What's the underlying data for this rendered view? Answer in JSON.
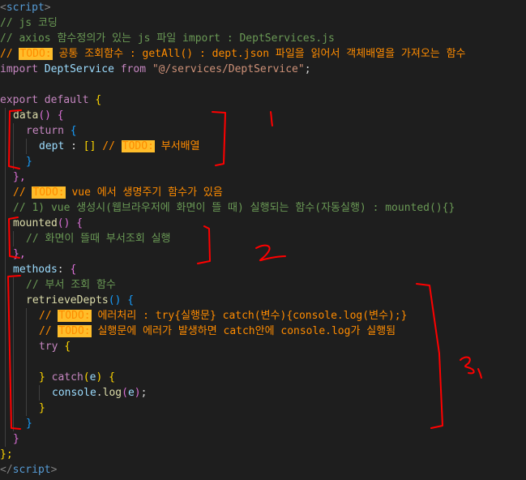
{
  "code": {
    "l1_open": "<",
    "l1_tag": "script",
    "l1_close": ">",
    "l2": "// js 코딩",
    "l3": "// axios 함수정의가 있는 js 파일 import : DeptServices.js",
    "l4_prefix": "// ",
    "todo": "TODO:",
    "l4_text": " 공통 조회함수 : getAll() : dept.json 파일을 읽어서 객체배열을 가져오는 함수",
    "l5_import": "import",
    "l5_name": "DeptService",
    "l5_from": "from",
    "l5_path": "\"@/services/DeptService\"",
    "l5_semi": ";",
    "l7_export": "export",
    "l7_default": "default",
    "l7_brace": "{",
    "l8_fn": "data",
    "l8_parens": "()",
    "l8_brace": "{",
    "l9_return": "return",
    "l9_brace": "{",
    "l10_prop": "dept",
    "l10_colon": " : ",
    "l10_arr": "[]",
    "l10_cm": " // ",
    "l10_todo_text": " 부서배열",
    "l11_brace": "}",
    "l12_brace": "},",
    "l13_prefix": "// ",
    "l13_text": " vue 에서 생명주기 함수가 있음",
    "l14": "// 1) vue 생성시(웹브라우저에 화면이 뜰 때) 실행되는 함수(자동실행) : mounted(){}",
    "l15_fn": "mounted",
    "l15_parens": "()",
    "l15_brace": "{",
    "l16": "// 화면이 뜰때 부서조회 실행",
    "l17_brace": "},",
    "l18_prop": "methods",
    "l18_colon": ": ",
    "l18_brace": "{",
    "l19": "// 부서 조회 함수",
    "l20_fn": "retrieveDepts",
    "l20_parens": "()",
    "l20_brace": "{",
    "l21_prefix": "// ",
    "l21_text": " 에러처리 : try{실행문} catch(변수){console.log(변수);}",
    "l22_prefix": "// ",
    "l22_text": " 실행문에 에러가 발생하면 catch안에 console.log가 실행됨",
    "l23_try": "try",
    "l23_brace": "{",
    "l25_brace": "}",
    "l25_catch": "catch",
    "l25_paren_open": "(",
    "l25_var": "e",
    "l25_paren_close": ")",
    "l25_brace2": "{",
    "l26_obj": "console",
    "l26_dot": ".",
    "l26_fn": "log",
    "l26_paren_open": "(",
    "l26_var": "e",
    "l26_paren_close": ")",
    "l26_semi": ";",
    "l27_brace": "}",
    "l28_brace": "}",
    "l29_brace": "}",
    "l30_brace": "};",
    "l31_open": "</",
    "l31_tag": "script",
    "l31_close": ">"
  },
  "annotations": {
    "marks": [
      "1",
      "2",
      "3"
    ],
    "color": "#ff0000"
  },
  "colors": {
    "background": "#1e1e1e",
    "comment": "#6a9955",
    "todo_highlight": "#ffbd2a",
    "todo_text": "#ff8c00",
    "keyword": "#c586c0",
    "function": "#dcdcaa",
    "variable": "#9cdcfe",
    "string": "#ce9178"
  }
}
